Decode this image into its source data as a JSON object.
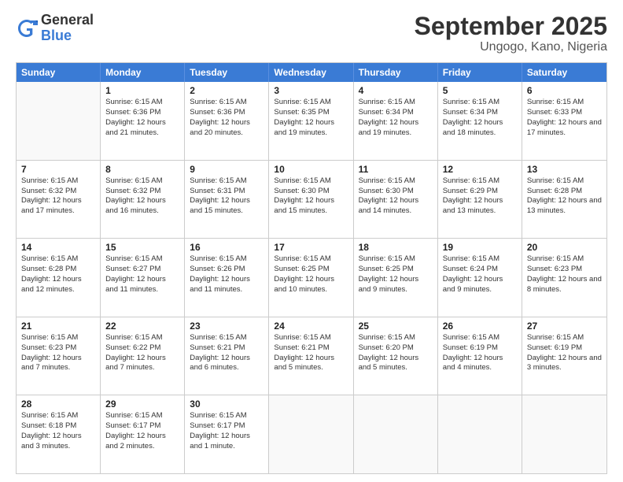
{
  "header": {
    "logo_general": "General",
    "logo_blue": "Blue",
    "month_title": "September 2025",
    "location": "Ungogo, Kano, Nigeria"
  },
  "calendar": {
    "days_of_week": [
      "Sunday",
      "Monday",
      "Tuesday",
      "Wednesday",
      "Thursday",
      "Friday",
      "Saturday"
    ],
    "weeks": [
      [
        {
          "day": "",
          "sunrise": "",
          "sunset": "",
          "daylight": ""
        },
        {
          "day": "1",
          "sunrise": "Sunrise: 6:15 AM",
          "sunset": "Sunset: 6:36 PM",
          "daylight": "Daylight: 12 hours and 21 minutes."
        },
        {
          "day": "2",
          "sunrise": "Sunrise: 6:15 AM",
          "sunset": "Sunset: 6:36 PM",
          "daylight": "Daylight: 12 hours and 20 minutes."
        },
        {
          "day": "3",
          "sunrise": "Sunrise: 6:15 AM",
          "sunset": "Sunset: 6:35 PM",
          "daylight": "Daylight: 12 hours and 19 minutes."
        },
        {
          "day": "4",
          "sunrise": "Sunrise: 6:15 AM",
          "sunset": "Sunset: 6:34 PM",
          "daylight": "Daylight: 12 hours and 19 minutes."
        },
        {
          "day": "5",
          "sunrise": "Sunrise: 6:15 AM",
          "sunset": "Sunset: 6:34 PM",
          "daylight": "Daylight: 12 hours and 18 minutes."
        },
        {
          "day": "6",
          "sunrise": "Sunrise: 6:15 AM",
          "sunset": "Sunset: 6:33 PM",
          "daylight": "Daylight: 12 hours and 17 minutes."
        }
      ],
      [
        {
          "day": "7",
          "sunrise": "Sunrise: 6:15 AM",
          "sunset": "Sunset: 6:32 PM",
          "daylight": "Daylight: 12 hours and 17 minutes."
        },
        {
          "day": "8",
          "sunrise": "Sunrise: 6:15 AM",
          "sunset": "Sunset: 6:32 PM",
          "daylight": "Daylight: 12 hours and 16 minutes."
        },
        {
          "day": "9",
          "sunrise": "Sunrise: 6:15 AM",
          "sunset": "Sunset: 6:31 PM",
          "daylight": "Daylight: 12 hours and 15 minutes."
        },
        {
          "day": "10",
          "sunrise": "Sunrise: 6:15 AM",
          "sunset": "Sunset: 6:30 PM",
          "daylight": "Daylight: 12 hours and 15 minutes."
        },
        {
          "day": "11",
          "sunrise": "Sunrise: 6:15 AM",
          "sunset": "Sunset: 6:30 PM",
          "daylight": "Daylight: 12 hours and 14 minutes."
        },
        {
          "day": "12",
          "sunrise": "Sunrise: 6:15 AM",
          "sunset": "Sunset: 6:29 PM",
          "daylight": "Daylight: 12 hours and 13 minutes."
        },
        {
          "day": "13",
          "sunrise": "Sunrise: 6:15 AM",
          "sunset": "Sunset: 6:28 PM",
          "daylight": "Daylight: 12 hours and 13 minutes."
        }
      ],
      [
        {
          "day": "14",
          "sunrise": "Sunrise: 6:15 AM",
          "sunset": "Sunset: 6:28 PM",
          "daylight": "Daylight: 12 hours and 12 minutes."
        },
        {
          "day": "15",
          "sunrise": "Sunrise: 6:15 AM",
          "sunset": "Sunset: 6:27 PM",
          "daylight": "Daylight: 12 hours and 11 minutes."
        },
        {
          "day": "16",
          "sunrise": "Sunrise: 6:15 AM",
          "sunset": "Sunset: 6:26 PM",
          "daylight": "Daylight: 12 hours and 11 minutes."
        },
        {
          "day": "17",
          "sunrise": "Sunrise: 6:15 AM",
          "sunset": "Sunset: 6:25 PM",
          "daylight": "Daylight: 12 hours and 10 minutes."
        },
        {
          "day": "18",
          "sunrise": "Sunrise: 6:15 AM",
          "sunset": "Sunset: 6:25 PM",
          "daylight": "Daylight: 12 hours and 9 minutes."
        },
        {
          "day": "19",
          "sunrise": "Sunrise: 6:15 AM",
          "sunset": "Sunset: 6:24 PM",
          "daylight": "Daylight: 12 hours and 9 minutes."
        },
        {
          "day": "20",
          "sunrise": "Sunrise: 6:15 AM",
          "sunset": "Sunset: 6:23 PM",
          "daylight": "Daylight: 12 hours and 8 minutes."
        }
      ],
      [
        {
          "day": "21",
          "sunrise": "Sunrise: 6:15 AM",
          "sunset": "Sunset: 6:23 PM",
          "daylight": "Daylight: 12 hours and 7 minutes."
        },
        {
          "day": "22",
          "sunrise": "Sunrise: 6:15 AM",
          "sunset": "Sunset: 6:22 PM",
          "daylight": "Daylight: 12 hours and 7 minutes."
        },
        {
          "day": "23",
          "sunrise": "Sunrise: 6:15 AM",
          "sunset": "Sunset: 6:21 PM",
          "daylight": "Daylight: 12 hours and 6 minutes."
        },
        {
          "day": "24",
          "sunrise": "Sunrise: 6:15 AM",
          "sunset": "Sunset: 6:21 PM",
          "daylight": "Daylight: 12 hours and 5 minutes."
        },
        {
          "day": "25",
          "sunrise": "Sunrise: 6:15 AM",
          "sunset": "Sunset: 6:20 PM",
          "daylight": "Daylight: 12 hours and 5 minutes."
        },
        {
          "day": "26",
          "sunrise": "Sunrise: 6:15 AM",
          "sunset": "Sunset: 6:19 PM",
          "daylight": "Daylight: 12 hours and 4 minutes."
        },
        {
          "day": "27",
          "sunrise": "Sunrise: 6:15 AM",
          "sunset": "Sunset: 6:19 PM",
          "daylight": "Daylight: 12 hours and 3 minutes."
        }
      ],
      [
        {
          "day": "28",
          "sunrise": "Sunrise: 6:15 AM",
          "sunset": "Sunset: 6:18 PM",
          "daylight": "Daylight: 12 hours and 3 minutes."
        },
        {
          "day": "29",
          "sunrise": "Sunrise: 6:15 AM",
          "sunset": "Sunset: 6:17 PM",
          "daylight": "Daylight: 12 hours and 2 minutes."
        },
        {
          "day": "30",
          "sunrise": "Sunrise: 6:15 AM",
          "sunset": "Sunset: 6:17 PM",
          "daylight": "Daylight: 12 hours and 1 minute."
        },
        {
          "day": "",
          "sunrise": "",
          "sunset": "",
          "daylight": ""
        },
        {
          "day": "",
          "sunrise": "",
          "sunset": "",
          "daylight": ""
        },
        {
          "day": "",
          "sunrise": "",
          "sunset": "",
          "daylight": ""
        },
        {
          "day": "",
          "sunrise": "",
          "sunset": "",
          "daylight": ""
        }
      ]
    ]
  }
}
